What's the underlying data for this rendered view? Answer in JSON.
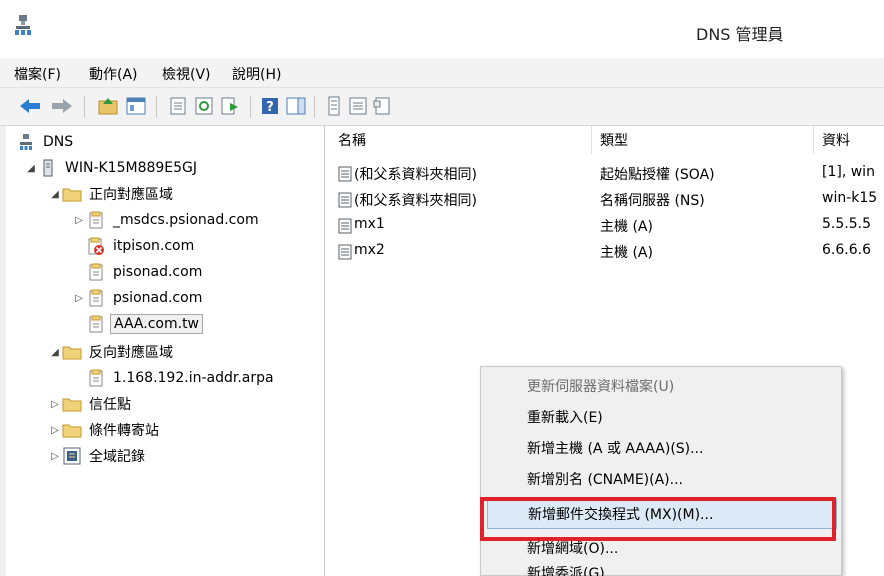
{
  "window": {
    "title": "DNS 管理員"
  },
  "menubar": [
    "檔案(F)",
    "動作(A)",
    "檢視(V)",
    "說明(H)"
  ],
  "toolbar": [
    {
      "icon": "back-arrow-icon"
    },
    {
      "icon": "forward-arrow-icon"
    },
    {
      "icon": "up-folder-icon"
    },
    {
      "icon": "show-hide-tree-icon"
    },
    {
      "icon": "properties-icon"
    },
    {
      "icon": "refresh-icon"
    },
    {
      "icon": "export-list-icon"
    },
    {
      "icon": "help-icon"
    },
    {
      "icon": "action-pane-icon"
    },
    {
      "icon": "new-record-icon"
    },
    {
      "icon": "list-icon"
    },
    {
      "icon": "detail-icon"
    }
  ],
  "tree": {
    "root": "DNS",
    "server": "WIN-K15M889E5GJ",
    "forward_zones": "正向對應區域",
    "fz_items": [
      "_msdcs.psionad.com",
      "itpison.com",
      "pisonad.com",
      "psionad.com",
      "AAA.com.tw"
    ],
    "reverse_zones": "反向對應區域",
    "rz_items": [
      "1.168.192.in-addr.arpa"
    ],
    "trust_points": "信任點",
    "conditional_forwarders": "條件轉寄站",
    "global_logs": "全域記錄"
  },
  "list": {
    "columns": [
      "名稱",
      "類型",
      "資料"
    ],
    "rows": [
      {
        "name": "(和父系資料夾相同)",
        "type": "起始點授權 (SOA)",
        "data": "[1], win"
      },
      {
        "name": "(和父系資料夾相同)",
        "type": "名稱伺服器 (NS)",
        "data": "win-k15"
      },
      {
        "name": "mx1",
        "type": "主機 (A)",
        "data": "5.5.5.5"
      },
      {
        "name": "mx2",
        "type": "主機 (A)",
        "data": "6.6.6.6"
      }
    ]
  },
  "context_menu": {
    "items": [
      "更新伺服器資料檔案(U)",
      "重新載入(E)",
      "新增主機 (A 或 AAAA)(S)...",
      "新增別名 (CNAME)(A)...",
      "新增郵件交換程式 (MX)(M)...",
      "新增網域(O)...",
      "新增委派(G)..."
    ]
  },
  "colors": {
    "highlight_box": "#e0222a",
    "selection_bg": "#dce9f7"
  }
}
